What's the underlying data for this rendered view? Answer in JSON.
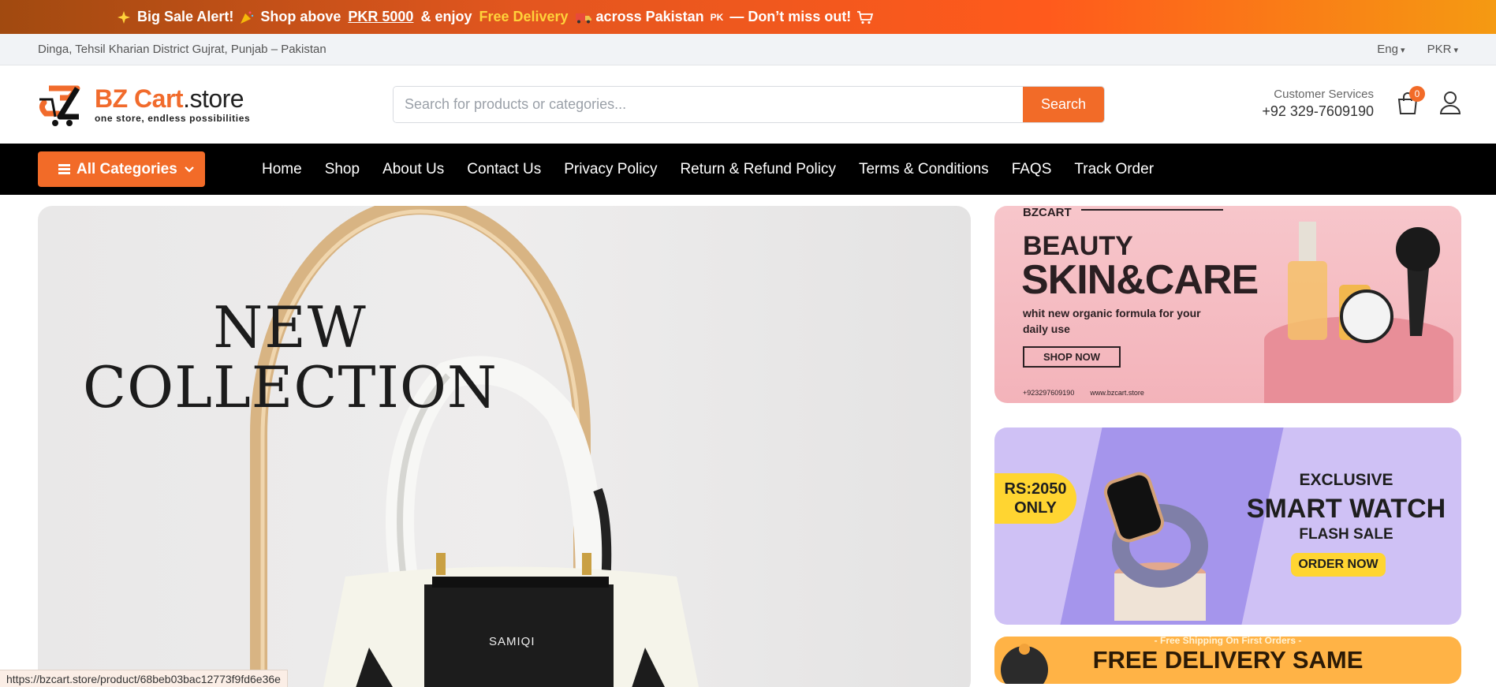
{
  "announcement": {
    "lead": "Big Sale Alert!",
    "shop_above": "Shop above",
    "amount": "PKR 5000",
    "and_enjoy": "& enjoy",
    "free": "Free Delivery",
    "across": "across Pakistan",
    "flag": "PK",
    "tail": "— Don’t miss out!"
  },
  "topbar": {
    "location": "Dinga, Tehsil Kharian District Gujrat, Punjab – Pakistan",
    "language": "Eng",
    "currency": "PKR"
  },
  "header": {
    "brand_main": "BZ Cart",
    "brand_suffix": ".store",
    "tagline": "one store, endless possibilities",
    "search_placeholder": "Search for products or categories...",
    "search_button": "Search",
    "customer_services_label": "Customer Services",
    "phone": "+92 329-7609190",
    "cart_count": "0"
  },
  "nav": {
    "all_categories": "All Categories",
    "items": [
      "Home",
      "Shop",
      "About Us",
      "Contact Us",
      "Privacy Policy",
      "Return & Refund Policy",
      "Terms & Conditions",
      "FAQS",
      "Track Order"
    ]
  },
  "hero": {
    "line1": "NEW",
    "line2": "COLLECTION",
    "bag_brand": "SAMIQI"
  },
  "banners": {
    "beauty": {
      "brand": "BZCART",
      "line1": "BEAUTY",
      "line2": "SKIN&CARE",
      "desc": "whit new organic formula for your daily use",
      "button": "SHOP NOW",
      "phone": "+923297609190",
      "site": "www.bzcart.store"
    },
    "watch": {
      "price": "RS:2050",
      "price_sub": "ONLY",
      "line1": "EXCLUSIVE",
      "line2": "SMART WATCH",
      "line3": "FLASH SALE",
      "button": "ORDER NOW"
    },
    "delivery": {
      "top": "- Free Shipping On First Orders -",
      "main": "FREE DELIVERY SAME"
    }
  },
  "status_url": "https://bzcart.store/product/68beb03bac12773f9fd6e36e",
  "colors": {
    "accent": "#f26b28",
    "nav_bg": "#000000",
    "free_text": "#ffd23a"
  }
}
